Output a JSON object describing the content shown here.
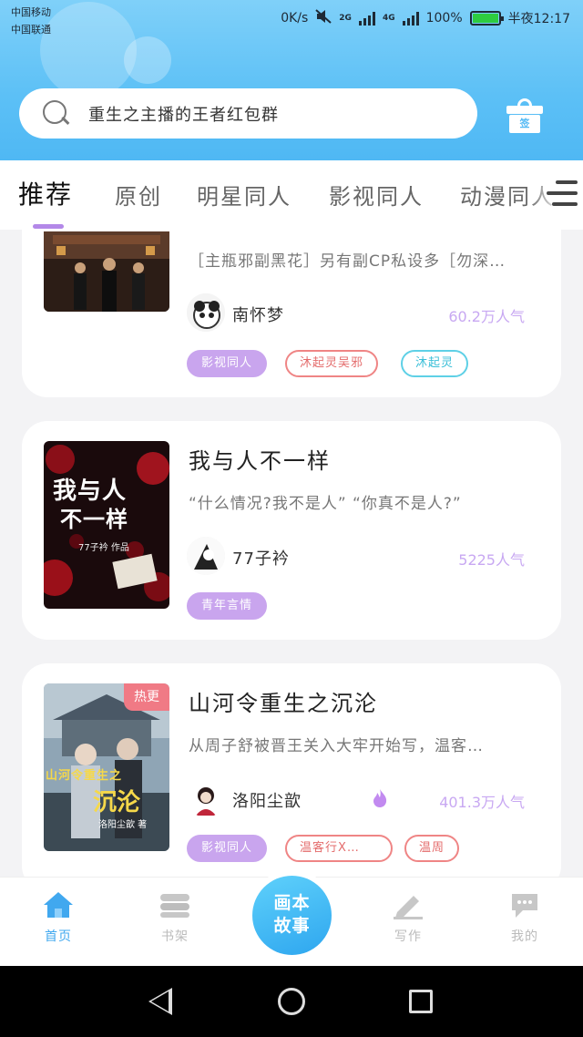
{
  "status_bar": {
    "carrier_1": "中国移动",
    "carrier_2": "中国联通",
    "speed": "0K/s",
    "network_1": "2G",
    "network_2": "4G",
    "battery": "100%",
    "time": "半夜12:17"
  },
  "search": {
    "placeholder": "重生之主播的王者红包群"
  },
  "checkin": {
    "label": "签"
  },
  "tabs": [
    {
      "label": "推荐",
      "active": true
    },
    {
      "label": "原创"
    },
    {
      "label": "明星同人"
    },
    {
      "label": "影视同人"
    },
    {
      "label": "动漫同人"
    }
  ],
  "cards": [
    {
      "title": "",
      "desc": "［主瓶邪副黑花］另有副CP私设多［勿深…",
      "author": "南怀梦",
      "popularity": "60.2万人气",
      "tags": [
        "影视同人",
        "沐起灵吴邪",
        "沐起灵"
      ]
    },
    {
      "title": "我与人不一样",
      "desc": "“什么情况?我不是人” “你真不是人?”",
      "author": "77子衿",
      "popularity": "5225人气",
      "tags": [
        "青年言情"
      ],
      "cover_text_1": "我与人",
      "cover_text_2": "不一样",
      "cover_author": "77子衿 作品"
    },
    {
      "title": "山河令重生之沉沦",
      "desc": "从周子舒被晋王关入大牢开始写，温客…",
      "author": "洛阳尘歆",
      "popularity": "401.3万人气",
      "tags": [
        "影视同人",
        "温客行X…",
        "温周"
      ],
      "badge": "热更",
      "cover_text_1": "山河令重生之",
      "cover_text_2": "沉沦",
      "cover_author": "洛阳尘歆 著"
    }
  ],
  "bottom_nav": {
    "home": "首页",
    "shelf": "书架",
    "fab": "画本故事",
    "write": "写作",
    "mine": "我的"
  },
  "colors": {
    "accent": "#41a8ef",
    "header": "#5cc0f6",
    "tag_purple": "#c9a5ee"
  }
}
